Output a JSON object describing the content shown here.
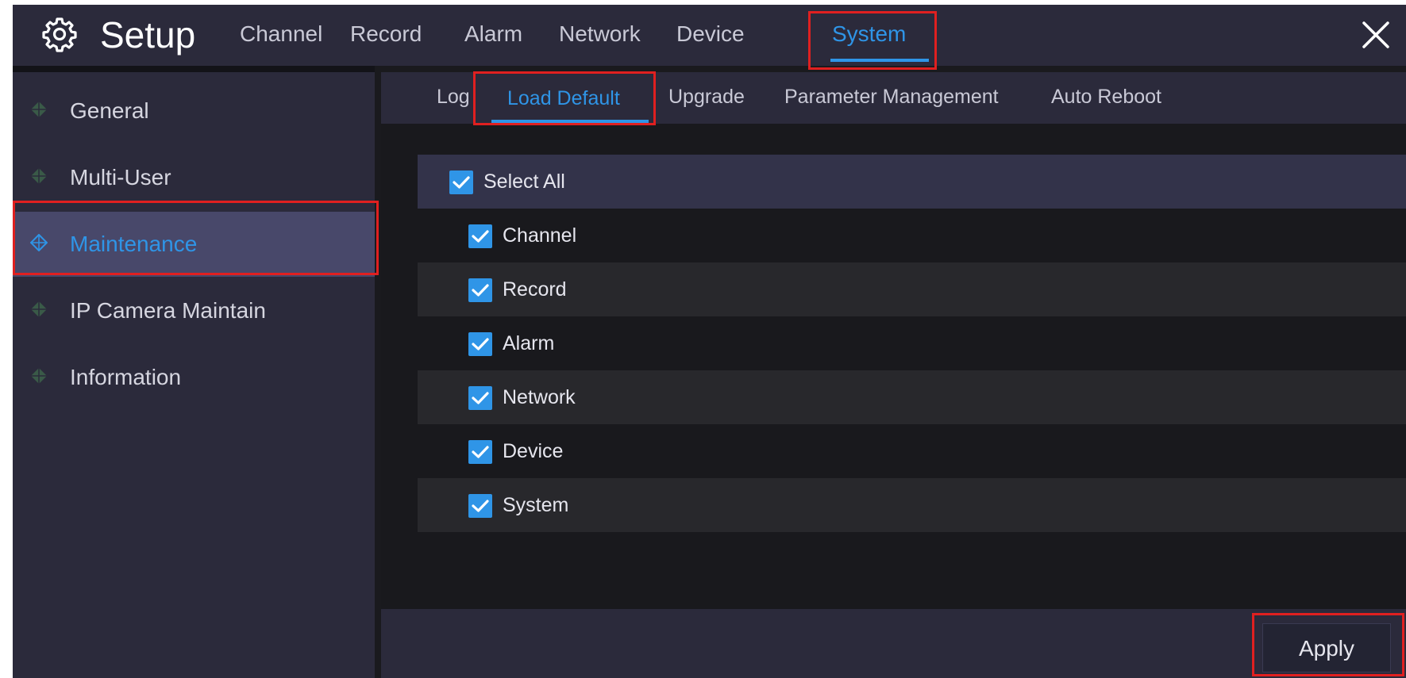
{
  "header": {
    "title": "Setup",
    "gear_icon": "gear-icon",
    "close_icon": "close-icon",
    "tabs": [
      {
        "label": "Channel",
        "active": false
      },
      {
        "label": "Record",
        "active": false
      },
      {
        "label": "Alarm",
        "active": false
      },
      {
        "label": "Network",
        "active": false
      },
      {
        "label": "Device",
        "active": false
      },
      {
        "label": "System",
        "active": true
      }
    ]
  },
  "sidebar": {
    "items": [
      {
        "label": "General",
        "active": false,
        "icon": "diamond-icon"
      },
      {
        "label": "Multi-User",
        "active": false,
        "icon": "diamond-icon"
      },
      {
        "label": "Maintenance",
        "active": true,
        "icon": "diamond-icon"
      },
      {
        "label": "IP Camera Maintain",
        "active": false,
        "icon": "diamond-icon"
      },
      {
        "label": "Information",
        "active": false,
        "icon": "diamond-icon"
      }
    ]
  },
  "subtabs": [
    {
      "label": "Log",
      "active": false
    },
    {
      "label": "Load Default",
      "active": true
    },
    {
      "label": "Upgrade",
      "active": false
    },
    {
      "label": "Parameter Management",
      "active": false
    },
    {
      "label": "Auto Reboot",
      "active": false
    }
  ],
  "load_default": {
    "select_all": {
      "label": "Select All",
      "checked": true
    },
    "items": [
      {
        "label": "Channel",
        "checked": true
      },
      {
        "label": "Record",
        "checked": true
      },
      {
        "label": "Alarm",
        "checked": true
      },
      {
        "label": "Network",
        "checked": true
      },
      {
        "label": "Device",
        "checked": true
      },
      {
        "label": "System",
        "checked": true
      }
    ]
  },
  "footer": {
    "apply_label": "Apply"
  },
  "colors": {
    "accent": "#2f95e7",
    "highlight": "#e02020",
    "panel": "#2b2a3b",
    "background": "#1a1a1e"
  }
}
